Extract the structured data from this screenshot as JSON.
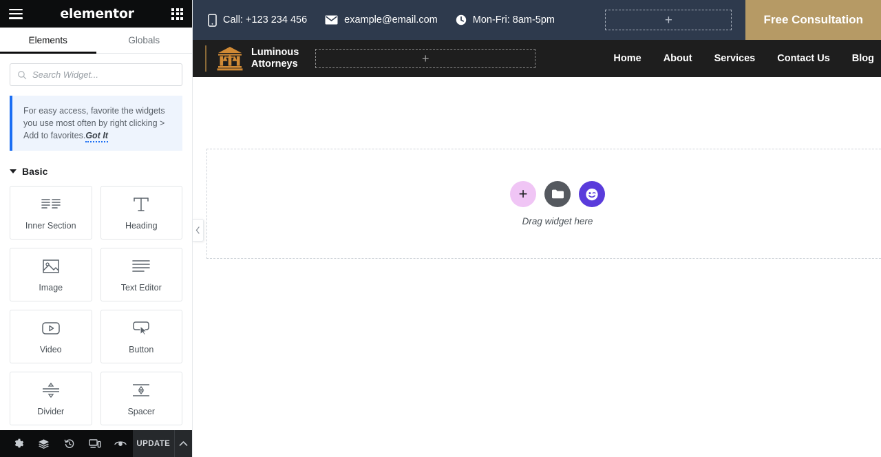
{
  "editor": {
    "brand": "elementor",
    "menu_icon": "hamburger-icon",
    "apps_icon": "grid-apps-icon",
    "tabs": [
      {
        "label": "Elements",
        "active": true
      },
      {
        "label": "Globals",
        "active": false
      }
    ],
    "search": {
      "placeholder": "Search Widget...",
      "value": "",
      "icon": "search-icon"
    },
    "notice": {
      "text": "For easy access, favorite the widgets you use most often by right clicking > Add to favorites.",
      "cta": "Got It",
      "accent_color": "#1b6ef3",
      "background": "#eef4fd"
    },
    "section": {
      "title": "Basic",
      "expanded": true
    },
    "widgets": [
      {
        "label": "Inner Section",
        "icon": "inner-section-icon"
      },
      {
        "label": "Heading",
        "icon": "heading-icon"
      },
      {
        "label": "Image",
        "icon": "image-icon"
      },
      {
        "label": "Text Editor",
        "icon": "text-editor-icon"
      },
      {
        "label": "Video",
        "icon": "video-icon"
      },
      {
        "label": "Button",
        "icon": "button-icon"
      },
      {
        "label": "Divider",
        "icon": "divider-icon"
      },
      {
        "label": "Spacer",
        "icon": "spacer-icon"
      }
    ],
    "bottom_bar": {
      "tools": [
        {
          "name": "settings",
          "icon": "gear-icon"
        },
        {
          "name": "navigator",
          "icon": "layers-icon"
        },
        {
          "name": "history",
          "icon": "history-clock-icon"
        },
        {
          "name": "responsive",
          "icon": "devices-icon"
        },
        {
          "name": "preview",
          "icon": "eye-icon"
        }
      ],
      "update_label": "UPDATE",
      "expand_icon": "chevron-up-icon"
    },
    "collapse_handle_icon": "chevron-left-icon"
  },
  "site": {
    "topbar": {
      "background": "#2e3a4d",
      "items": [
        {
          "icon": "mobile-phone-icon",
          "text": "Call: +123 234 456"
        },
        {
          "icon": "envelope-icon",
          "text": "example@email.com"
        },
        {
          "icon": "clock-icon",
          "text": "Mon-Fri: 8am-5pm"
        }
      ],
      "dropzone_icon": "plus-icon",
      "cta_label": "Free Consultation",
      "cta_color": "#b69a65"
    },
    "header": {
      "background": "#1e1e1e",
      "logo_icon": "courthouse-scales-icon",
      "logo_color": "#d08a35",
      "logo_line1": "Luminous",
      "logo_line2": "Attorneys",
      "dropzone_icon": "plus-icon",
      "nav": [
        {
          "label": "Home"
        },
        {
          "label": "About"
        },
        {
          "label": "Services"
        },
        {
          "label": "Contact Us"
        },
        {
          "label": "Blog"
        }
      ]
    },
    "canvas": {
      "drop_label": "Drag widget here",
      "buttons": [
        {
          "name": "add-element",
          "icon": "plus-icon",
          "color": "#f0c5f5"
        },
        {
          "name": "add-template",
          "icon": "folder-icon",
          "color": "#55595f"
        },
        {
          "name": "ai-builder",
          "icon": "ai-wink-face-icon",
          "color": "#5a3cdb"
        }
      ]
    }
  }
}
